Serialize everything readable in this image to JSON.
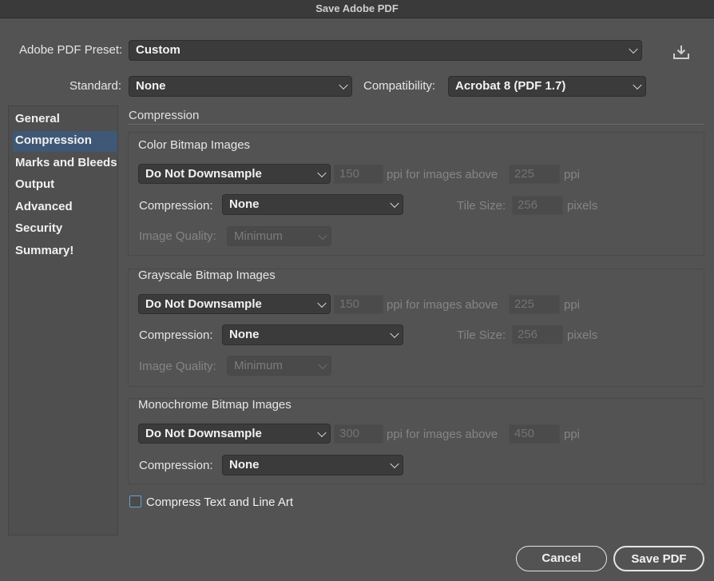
{
  "window": {
    "title": "Save Adobe PDF"
  },
  "preset": {
    "label": "Adobe PDF Preset:",
    "value": "Custom"
  },
  "standard": {
    "label": "Standard:",
    "value": "None"
  },
  "compatibility": {
    "label": "Compatibility:",
    "value": "Acrobat 8 (PDF 1.7)"
  },
  "sidebar": {
    "items": [
      {
        "label": "General"
      },
      {
        "label": "Compression"
      },
      {
        "label": "Marks and Bleeds"
      },
      {
        "label": "Output"
      },
      {
        "label": "Advanced"
      },
      {
        "label": "Security"
      },
      {
        "label": "Summary!"
      }
    ],
    "selected": "Compression"
  },
  "section": {
    "title": "Compression"
  },
  "color": {
    "title": "Color Bitmap Images",
    "downsample": "Do Not Downsample",
    "ppi": "150",
    "ppi_above_label": "ppi for images above",
    "above": "225",
    "ppi_unit": "ppi",
    "compression_label": "Compression:",
    "compression": "None",
    "tile_label": "Tile Size:",
    "tile": "256",
    "tile_unit": "pixels",
    "quality_label": "Image Quality:",
    "quality": "Minimum"
  },
  "gray": {
    "title": "Grayscale Bitmap Images",
    "downsample": "Do Not Downsample",
    "ppi": "150",
    "ppi_above_label": "ppi for images above",
    "above": "225",
    "ppi_unit": "ppi",
    "compression_label": "Compression:",
    "compression": "None",
    "tile_label": "Tile Size:",
    "tile": "256",
    "tile_unit": "pixels",
    "quality_label": "Image Quality:",
    "quality": "Minimum"
  },
  "mono": {
    "title": "Monochrome Bitmap Images",
    "downsample": "Do Not Downsample",
    "ppi": "300",
    "ppi_above_label": "ppi for images above",
    "above": "450",
    "ppi_unit": "ppi",
    "compression_label": "Compression:",
    "compression": "None"
  },
  "compress_text": {
    "label": "Compress Text and Line Art",
    "checked": false
  },
  "buttons": {
    "cancel": "Cancel",
    "save": "Save PDF"
  },
  "icons": {
    "save_preset": "download-icon"
  }
}
